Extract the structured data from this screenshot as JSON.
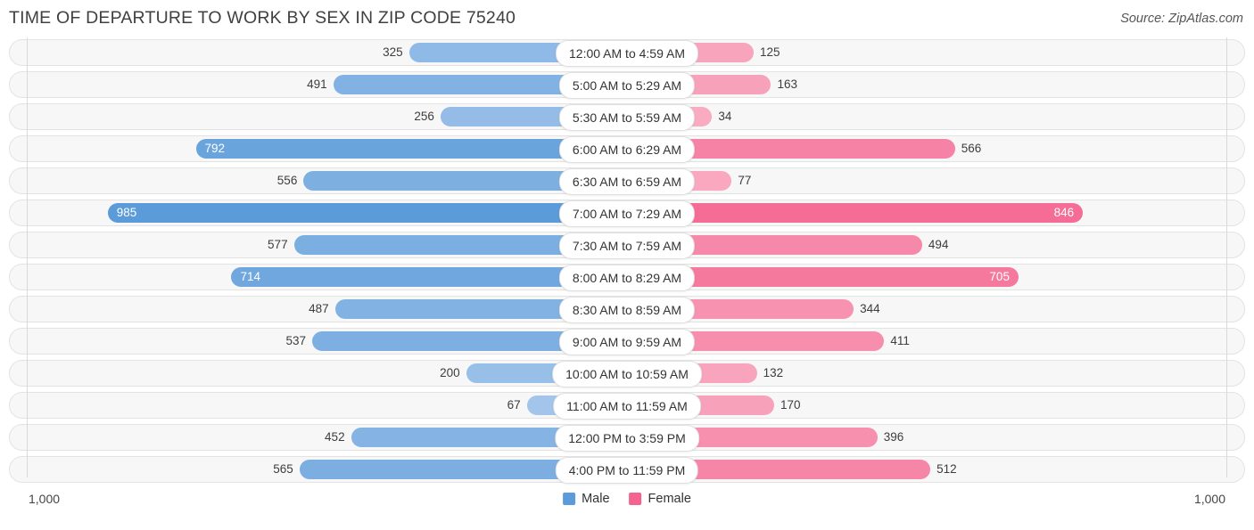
{
  "header": {
    "title": "TIME OF DEPARTURE TO WORK BY SEX IN ZIP CODE 75240",
    "source": "Source: ZipAtlas.com"
  },
  "footer": {
    "axis_min_label": "1,000",
    "axis_max_label": "1,000",
    "legend": [
      {
        "label": "Male",
        "color": "#5b9bd9"
      },
      {
        "label": "Female",
        "color": "#f4628e"
      }
    ]
  },
  "chart_data": {
    "type": "bar",
    "orientation": "horizontal-diverging",
    "title": "TIME OF DEPARTURE TO WORK BY SEX IN ZIP CODE 75240",
    "xlabel": "",
    "ylabel": "",
    "axis_left_max": 1000,
    "axis_right_max": 1000,
    "grid": false,
    "legend_position": "bottom-center",
    "categories": [
      "12:00 AM to 4:59 AM",
      "5:00 AM to 5:29 AM",
      "5:30 AM to 5:59 AM",
      "6:00 AM to 6:29 AM",
      "6:30 AM to 6:59 AM",
      "7:00 AM to 7:29 AM",
      "7:30 AM to 7:59 AM",
      "8:00 AM to 8:29 AM",
      "8:30 AM to 8:59 AM",
      "9:00 AM to 9:59 AM",
      "10:00 AM to 10:59 AM",
      "11:00 AM to 11:59 AM",
      "12:00 PM to 3:59 PM",
      "4:00 PM to 11:59 PM"
    ],
    "series": [
      {
        "name": "Male",
        "color": "#5b9bd9",
        "values": [
          325,
          491,
          256,
          792,
          556,
          985,
          577,
          714,
          487,
          537,
          200,
          67,
          452,
          565
        ]
      },
      {
        "name": "Female",
        "color": "#f4628e",
        "values": [
          125,
          163,
          34,
          566,
          77,
          846,
          494,
          705,
          344,
          411,
          132,
          170,
          396,
          512
        ]
      }
    ]
  }
}
